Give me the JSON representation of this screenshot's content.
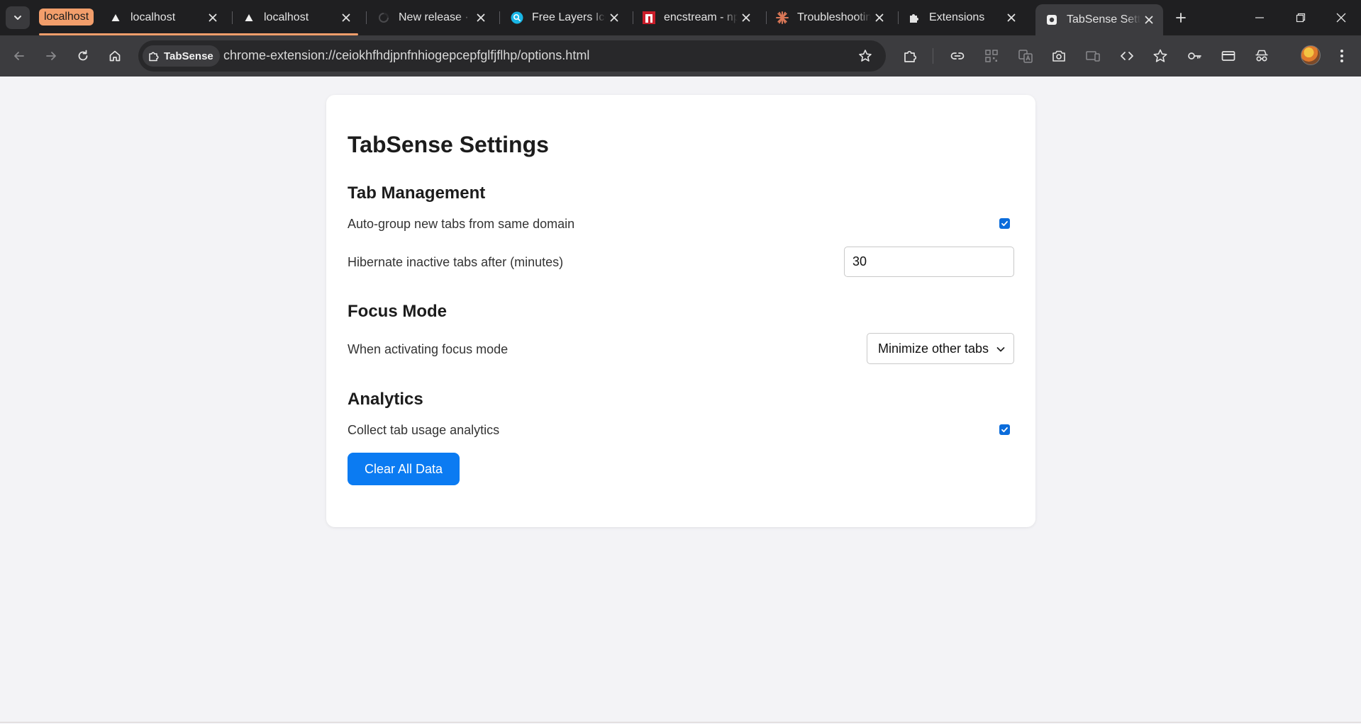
{
  "browser": {
    "tab_group_label": "localhost",
    "tabs": [
      {
        "title": "localhost",
        "icon": "triangle-icon",
        "active": false
      },
      {
        "title": "localhost",
        "icon": "triangle-icon",
        "active": false
      },
      {
        "title": "New release · t",
        "icon": "spinner-icon",
        "active": false
      },
      {
        "title": "Free Layers Ico",
        "icon": "search-circle-icon",
        "active": false
      },
      {
        "title": "encstream - np",
        "icon": "npm-icon",
        "active": false
      },
      {
        "title": "Troubleshootin",
        "icon": "claude-icon",
        "active": false
      },
      {
        "title": "Extensions",
        "icon": "puzzle-icon",
        "active": false
      },
      {
        "title": "TabSense Settir",
        "icon": "extension-page-icon",
        "active": true
      }
    ],
    "site_chip": "TabSense",
    "url": "chrome-extension://ceiokhfhdjpnfnhiogepcepfglfjflhp/options.html"
  },
  "page": {
    "title": "TabSense Settings",
    "sections": {
      "tab_management": {
        "heading": "Tab Management",
        "auto_group_label": "Auto-group new tabs from same domain",
        "auto_group_checked": true,
        "hibernate_label": "Hibernate inactive tabs after (minutes)",
        "hibernate_value": "30"
      },
      "focus_mode": {
        "heading": "Focus Mode",
        "activation_label": "When activating focus mode",
        "activation_selected": "Minimize other tabs"
      },
      "analytics": {
        "heading": "Analytics",
        "collect_label": "Collect tab usage analytics",
        "collect_checked": true,
        "clear_button": "Clear All Data"
      }
    }
  },
  "colors": {
    "accent": "#0b7bf2",
    "tab_group": "#f29e6b",
    "browser_frame": "#1f1f21",
    "toolbar": "#3c3c3f"
  }
}
